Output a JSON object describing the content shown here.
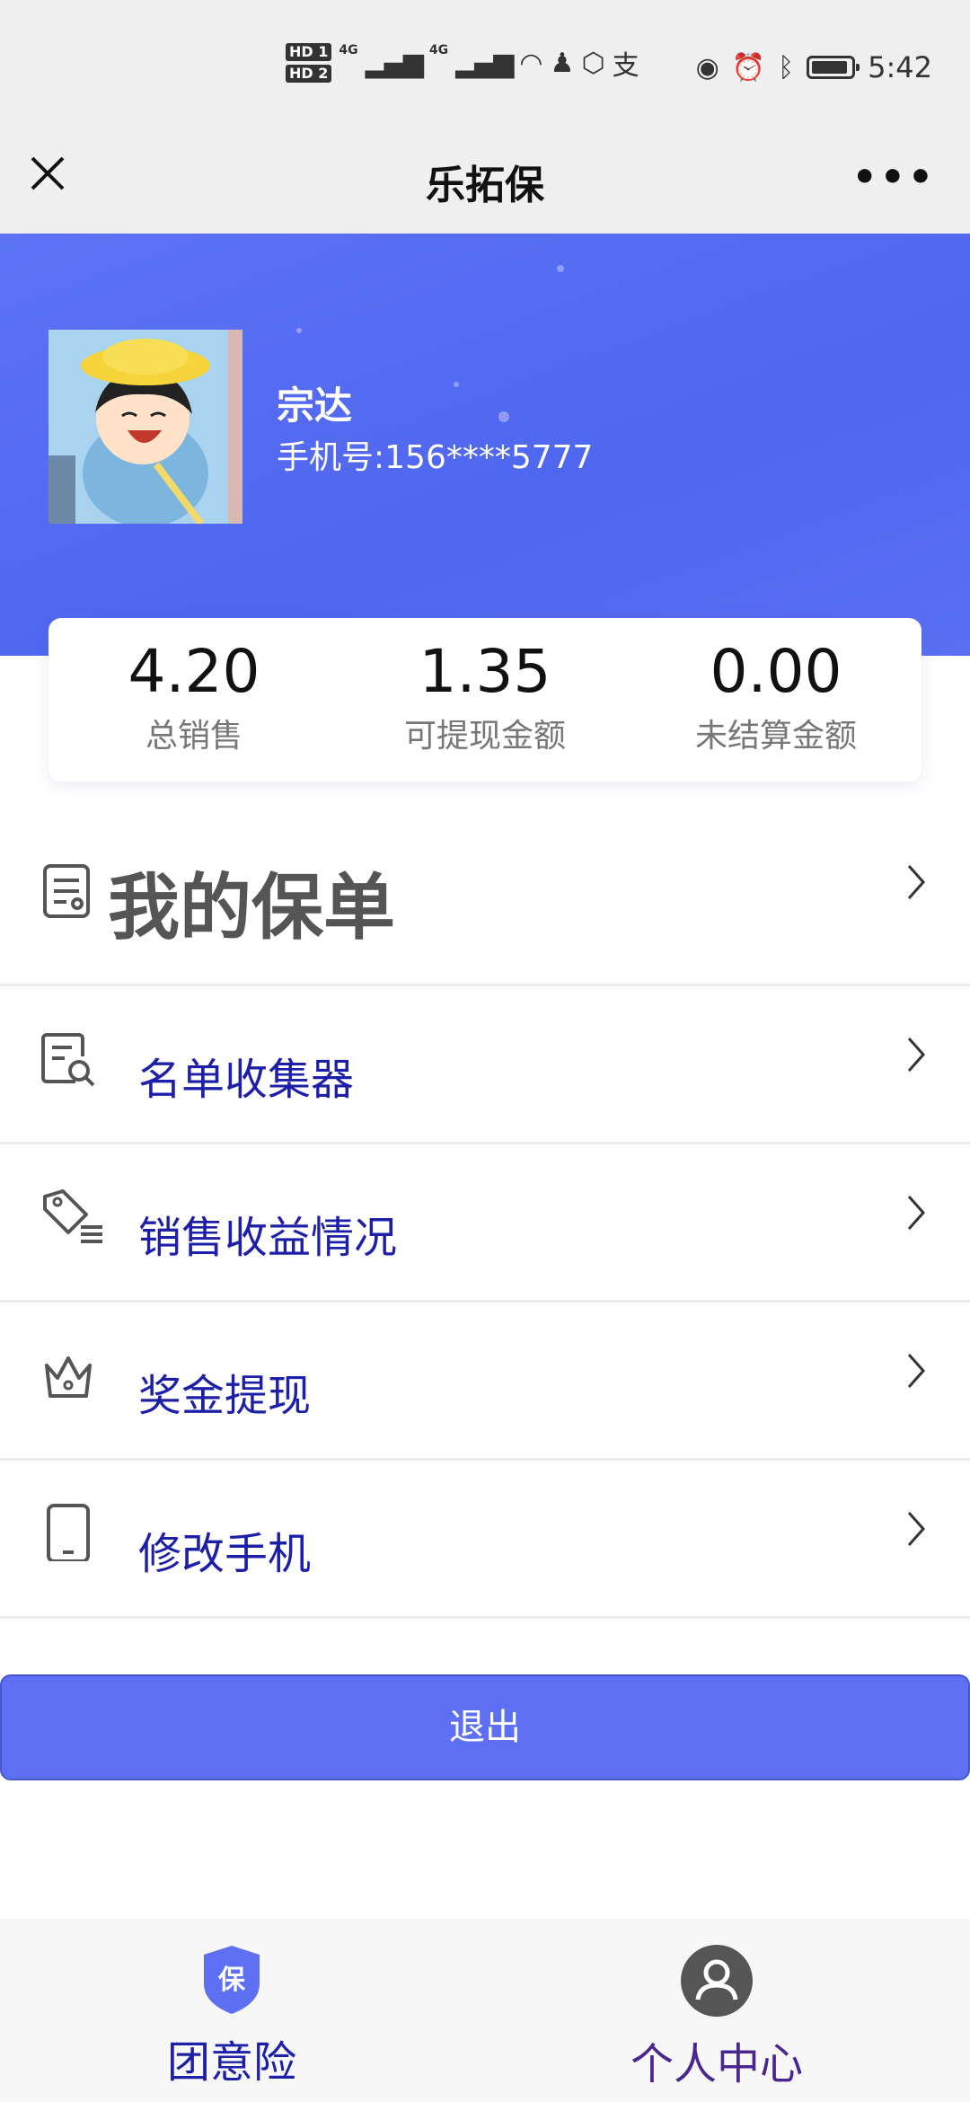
{
  "status_bar": {
    "hd1": "HD 1",
    "hd2": "HD 2",
    "net1": "4G",
    "net2": "4G",
    "time": "5:42"
  },
  "nav": {
    "title": "乐拓保",
    "more": "•••"
  },
  "user": {
    "name": "宗达",
    "phone": "手机号:156****5777"
  },
  "stats": [
    {
      "value": "4.20",
      "label": "总销售"
    },
    {
      "value": "1.35",
      "label": "可提现金额"
    },
    {
      "value": "0.00",
      "label": "未结算金额"
    }
  ],
  "menu": {
    "policy_label": "我的保单",
    "items": [
      {
        "label": "名单收集器",
        "icon": "document-search-icon"
      },
      {
        "label": "销售收益情况",
        "icon": "tag-icon"
      },
      {
        "label": "奖金提现",
        "icon": "crown-icon"
      },
      {
        "label": "修改手机",
        "icon": "phone-icon"
      }
    ]
  },
  "logout_label": "退出",
  "tabs": [
    {
      "label": "团意险",
      "icon_text": "保"
    },
    {
      "label": "个人中心"
    }
  ],
  "colors": {
    "brand": "#5d6ff2",
    "menu_text": "#1d1fa8",
    "tab_me": "#4a2790"
  }
}
